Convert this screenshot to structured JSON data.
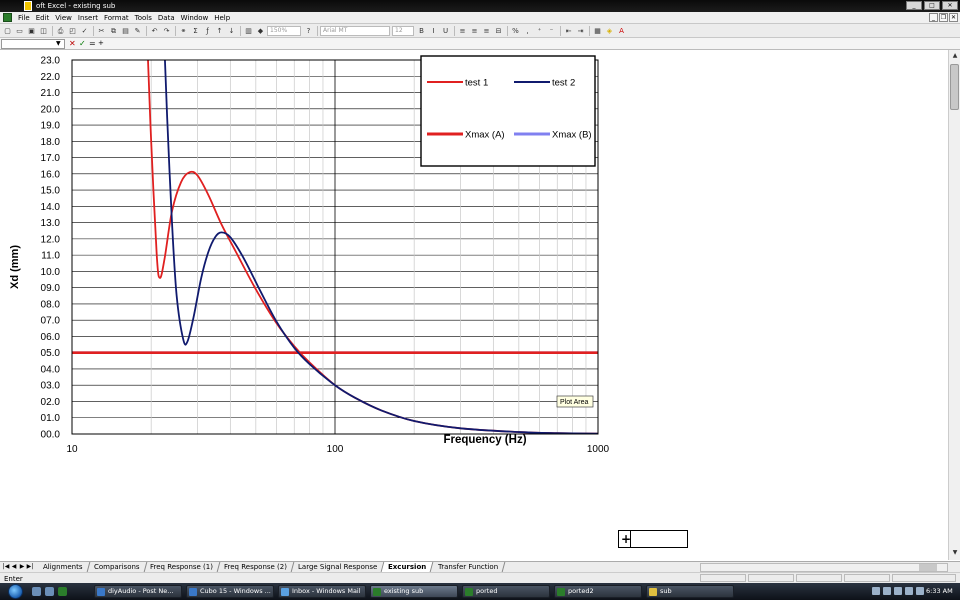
{
  "window": {
    "title": "oft Excel - existing sub"
  },
  "menu": [
    "File",
    "Edit",
    "View",
    "Insert",
    "Format",
    "Tools",
    "Data",
    "Window",
    "Help"
  ],
  "toolbar": {
    "zoom": "150%",
    "font": "Arial MT",
    "font_size": "12",
    "bold": "B",
    "italic": "I",
    "underline": "U"
  },
  "formula_bar": {
    "name_box": "",
    "cancel": "✕",
    "enter": "✓",
    "equals": "=",
    "content": "+"
  },
  "chart_data": {
    "type": "line",
    "xscale": "log",
    "xlim": [
      10,
      1000
    ],
    "ylim": [
      0,
      23.0
    ],
    "xticks": [
      "10",
      "100",
      "1000"
    ],
    "yticks": [
      "00.0",
      "01.0",
      "02.0",
      "03.0",
      "04.0",
      "05.0",
      "06.0",
      "07.0",
      "08.0",
      "09.0",
      "10.0",
      "11.0",
      "12.0",
      "13.0",
      "14.0",
      "15.0",
      "16.0",
      "17.0",
      "18.0",
      "19.0",
      "20.0",
      "21.0",
      "22.0",
      "23.0"
    ],
    "xlabel": "Frequency (Hz)",
    "ylabel": "Xd (mm)",
    "annotation": "Plot Area",
    "legend_position": "top-right",
    "series": [
      {
        "name": "test 1",
        "color": "#e02020",
        "x": [
          19.4,
          20,
          21,
          21.6,
          22.5,
          24,
          26,
          28,
          30,
          33,
          37,
          42,
          50,
          60,
          70,
          80,
          100,
          120,
          150,
          200,
          300,
          500,
          700,
          1000
        ],
        "y": [
          23.5,
          18.0,
          11.0,
          9.6,
          10.8,
          13.7,
          15.5,
          16.1,
          15.9,
          14.7,
          12.9,
          11.2,
          8.9,
          6.8,
          5.4,
          4.4,
          3.0,
          2.2,
          1.45,
          0.8,
          0.35,
          0.12,
          0.05,
          0.02
        ]
      },
      {
        "name": "test 2",
        "color": "#101a6e",
        "x": [
          22.5,
          23,
          24,
          25,
          26.5,
          27.5,
          29,
          31,
          33,
          35,
          37,
          40,
          45,
          52,
          60,
          70,
          80,
          100,
          120,
          150,
          200,
          300,
          500,
          700,
          1000
        ],
        "y": [
          23.5,
          19.5,
          13.0,
          8.5,
          5.8,
          5.7,
          7.2,
          9.6,
          11.2,
          12.1,
          12.4,
          12.1,
          10.8,
          8.8,
          6.9,
          5.3,
          4.3,
          3.0,
          2.2,
          1.45,
          0.8,
          0.35,
          0.12,
          0.05,
          0.02
        ]
      },
      {
        "name": "Xmax (A)",
        "color": "#e02020",
        "x": [
          10,
          1000
        ],
        "y": [
          5.0,
          5.0
        ]
      },
      {
        "name": "Xmax (B)",
        "color": "#8080f0",
        "x": [
          10,
          1000
        ],
        "y": [
          5.0,
          5.0
        ]
      }
    ]
  },
  "sheet_tabs": [
    "Alignments",
    "Comparisons",
    "Freq Response (1)",
    "Freq Response (2)",
    "Large Signal Response",
    "Excursion",
    "Transfer Function"
  ],
  "active_tab": "Excursion",
  "status": {
    "mode": "Enter"
  },
  "taskbar": {
    "tasks": [
      "diyAudio - Post Ne...",
      "Cubo 15 - Windows ...",
      "Inbox - Windows Mail",
      "existing sub",
      "ported",
      "ported2",
      "sub"
    ],
    "clock": "6:33 AM"
  }
}
